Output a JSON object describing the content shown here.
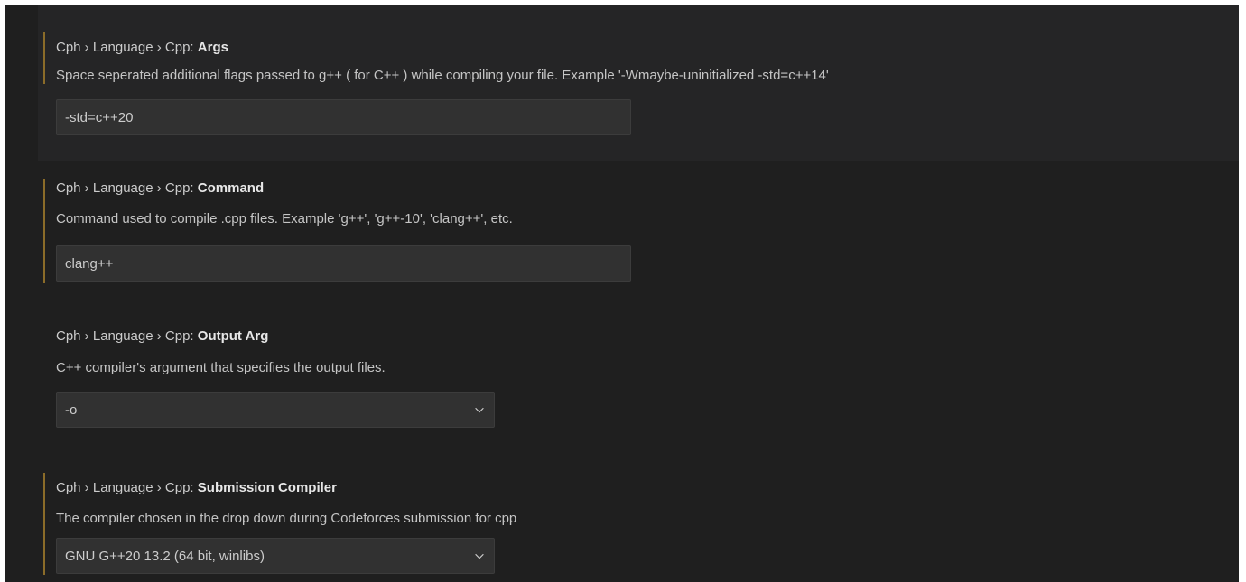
{
  "settings": [
    {
      "category": "Cph › Language › Cpp: ",
      "key": "Args",
      "description": "Space seperated additional flags passed to g++ ( for C++ ) while compiling your file. Example '-Wmaybe-uninitialized -std=c++14'",
      "value": "-std=c++20",
      "control": "text",
      "modified": true,
      "focused": true
    },
    {
      "category": "Cph › Language › Cpp: ",
      "key": "Command",
      "description": "Command used to compile .cpp files. Example 'g++', 'g++-10', 'clang++', etc.",
      "value": "clang++",
      "control": "text",
      "modified": true,
      "focused": false
    },
    {
      "category": "Cph › Language › Cpp: ",
      "key": "Output Arg",
      "description": "C++ compiler's argument that specifies the output files.",
      "value": "-o",
      "control": "dropdown",
      "modified": false,
      "focused": false
    },
    {
      "category": "Cph › Language › Cpp: ",
      "key": "Submission Compiler",
      "description": "The compiler chosen in the drop down during Codeforces submission for cpp",
      "value": "GNU G++20 13.2 (64 bit, winlibs)",
      "control": "dropdown",
      "modified": true,
      "focused": false
    }
  ],
  "colors": {
    "background": "#1f1f1f",
    "focused_row": "#252526",
    "modified_indicator": "#8b6c29",
    "input_background": "#313131",
    "input_border": "#3c3c3c"
  },
  "icons": {
    "dropdown": "chevron-down-icon"
  }
}
